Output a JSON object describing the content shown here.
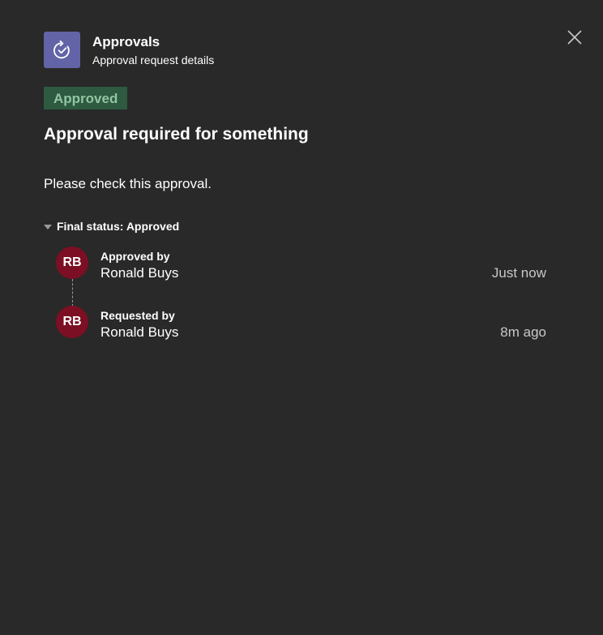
{
  "header": {
    "app_name": "Approvals",
    "subtitle": "Approval request details",
    "app_icon": "approvals-check-icon",
    "close_icon": "close-icon"
  },
  "request": {
    "status_badge": "Approved",
    "title": "Approval required for something",
    "description": "Please check this approval."
  },
  "final_status": {
    "label": "Final status: Approved",
    "entries": [
      {
        "initials": "RB",
        "role": "Approved by",
        "name": "Ronald Buys",
        "time": "Just now"
      },
      {
        "initials": "RB",
        "role": "Requested by",
        "name": "Ronald Buys",
        "time": "8m ago"
      }
    ]
  },
  "colors": {
    "background": "#292929",
    "app_icon_bg": "#6264a7",
    "badge_bg": "#2d5a40",
    "badge_text": "#92c5a1",
    "avatar_bg": "#7c0f23"
  }
}
